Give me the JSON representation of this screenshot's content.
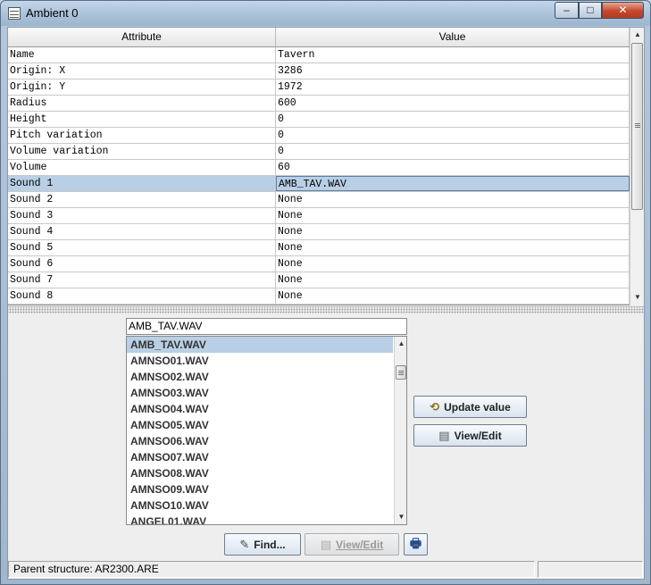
{
  "window": {
    "title": "Ambient 0",
    "controls": {
      "minimize": "–",
      "maximize": "□",
      "close": "✕"
    }
  },
  "table": {
    "headers": [
      "Attribute",
      "Value"
    ],
    "rows": [
      {
        "attribute": "Name",
        "value": "Tavern"
      },
      {
        "attribute": "Origin: X",
        "value": "3286"
      },
      {
        "attribute": "Origin: Y",
        "value": "1972"
      },
      {
        "attribute": "Radius",
        "value": "600"
      },
      {
        "attribute": "Height",
        "value": "0"
      },
      {
        "attribute": "Pitch variation",
        "value": "0"
      },
      {
        "attribute": "Volume variation",
        "value": "0"
      },
      {
        "attribute": "Volume",
        "value": "60"
      },
      {
        "attribute": "Sound 1",
        "value": "AMB_TAV.WAV",
        "selected": true
      },
      {
        "attribute": "Sound 2",
        "value": "None"
      },
      {
        "attribute": "Sound 3",
        "value": "None"
      },
      {
        "attribute": "Sound 4",
        "value": "None"
      },
      {
        "attribute": "Sound 5",
        "value": "None"
      },
      {
        "attribute": "Sound 6",
        "value": "None"
      },
      {
        "attribute": "Sound 7",
        "value": "None"
      },
      {
        "attribute": "Sound 8",
        "value": "None"
      }
    ]
  },
  "editor": {
    "value": "AMB_TAV.WAV",
    "options": [
      "AMB_TAV.WAV",
      "AMNSO01.WAV",
      "AMNSO02.WAV",
      "AMNSO03.WAV",
      "AMNSO04.WAV",
      "AMNSO05.WAV",
      "AMNSO06.WAV",
      "AMNSO07.WAV",
      "AMNSO08.WAV",
      "AMNSO09.WAV",
      "AMNSO10.WAV",
      "ANGEL01.WAV"
    ],
    "selected_option": "AMB_TAV.WAV",
    "update_label": "Update value",
    "view_edit_label": "View/Edit"
  },
  "toolbar": {
    "find_label": "Find...",
    "view_edit_label": "View/Edit"
  },
  "status": {
    "text": "Parent structure: AR2300.ARE"
  },
  "icons": {
    "update": "refresh-icon",
    "view_edit": "document-icon",
    "find": "find-wand-icon",
    "print": "printer-icon"
  },
  "colors": {
    "selection": "#b8cfe5",
    "window_frame": "#a9c0d8",
    "close_button": "#c2492d"
  }
}
